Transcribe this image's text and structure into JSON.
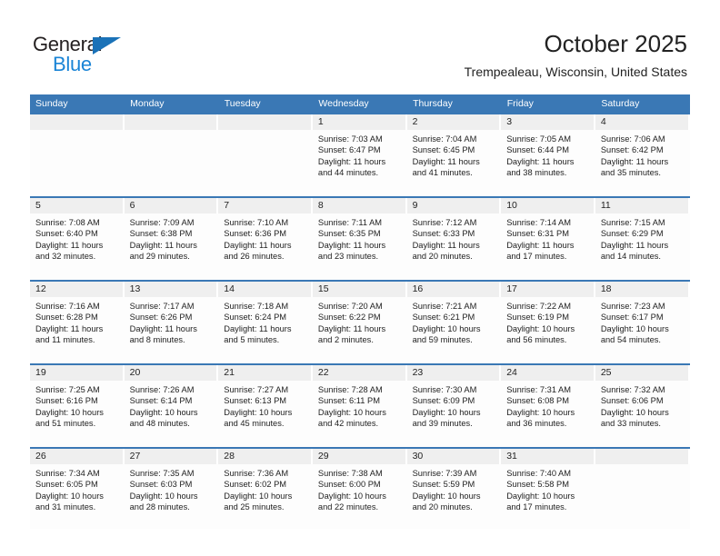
{
  "brand": {
    "name_part1": "General",
    "name_part2": "Blue",
    "triangle_color": "#1a72b8",
    "blue_color": "#1a84d6",
    "dark_color": "#231f20"
  },
  "header": {
    "title": "October 2025",
    "subtitle": "Trempealeau, Wisconsin, United States"
  },
  "theme": {
    "header_bar_color": "#3a78b5",
    "daynum_band_color": "#efefef",
    "row_rule_color": "#3a78b5",
    "text_color": "#222222"
  },
  "weekdays": [
    "Sunday",
    "Monday",
    "Tuesday",
    "Wednesday",
    "Thursday",
    "Friday",
    "Saturday"
  ],
  "weeks": [
    {
      "days": [
        {
          "num": "",
          "sunrise": "",
          "sunset": "",
          "daylight_line1": "",
          "daylight_line2": "",
          "empty": true
        },
        {
          "num": "",
          "sunrise": "",
          "sunset": "",
          "daylight_line1": "",
          "daylight_line2": "",
          "empty": true
        },
        {
          "num": "",
          "sunrise": "",
          "sunset": "",
          "daylight_line1": "",
          "daylight_line2": "",
          "empty": true
        },
        {
          "num": "1",
          "sunrise": "Sunrise: 7:03 AM",
          "sunset": "Sunset: 6:47 PM",
          "daylight_line1": "Daylight: 11 hours",
          "daylight_line2": "and 44 minutes.",
          "empty": false
        },
        {
          "num": "2",
          "sunrise": "Sunrise: 7:04 AM",
          "sunset": "Sunset: 6:45 PM",
          "daylight_line1": "Daylight: 11 hours",
          "daylight_line2": "and 41 minutes.",
          "empty": false
        },
        {
          "num": "3",
          "sunrise": "Sunrise: 7:05 AM",
          "sunset": "Sunset: 6:44 PM",
          "daylight_line1": "Daylight: 11 hours",
          "daylight_line2": "and 38 minutes.",
          "empty": false
        },
        {
          "num": "4",
          "sunrise": "Sunrise: 7:06 AM",
          "sunset": "Sunset: 6:42 PM",
          "daylight_line1": "Daylight: 11 hours",
          "daylight_line2": "and 35 minutes.",
          "empty": false
        }
      ]
    },
    {
      "days": [
        {
          "num": "5",
          "sunrise": "Sunrise: 7:08 AM",
          "sunset": "Sunset: 6:40 PM",
          "daylight_line1": "Daylight: 11 hours",
          "daylight_line2": "and 32 minutes.",
          "empty": false
        },
        {
          "num": "6",
          "sunrise": "Sunrise: 7:09 AM",
          "sunset": "Sunset: 6:38 PM",
          "daylight_line1": "Daylight: 11 hours",
          "daylight_line2": "and 29 minutes.",
          "empty": false
        },
        {
          "num": "7",
          "sunrise": "Sunrise: 7:10 AM",
          "sunset": "Sunset: 6:36 PM",
          "daylight_line1": "Daylight: 11 hours",
          "daylight_line2": "and 26 minutes.",
          "empty": false
        },
        {
          "num": "8",
          "sunrise": "Sunrise: 7:11 AM",
          "sunset": "Sunset: 6:35 PM",
          "daylight_line1": "Daylight: 11 hours",
          "daylight_line2": "and 23 minutes.",
          "empty": false
        },
        {
          "num": "9",
          "sunrise": "Sunrise: 7:12 AM",
          "sunset": "Sunset: 6:33 PM",
          "daylight_line1": "Daylight: 11 hours",
          "daylight_line2": "and 20 minutes.",
          "empty": false
        },
        {
          "num": "10",
          "sunrise": "Sunrise: 7:14 AM",
          "sunset": "Sunset: 6:31 PM",
          "daylight_line1": "Daylight: 11 hours",
          "daylight_line2": "and 17 minutes.",
          "empty": false
        },
        {
          "num": "11",
          "sunrise": "Sunrise: 7:15 AM",
          "sunset": "Sunset: 6:29 PM",
          "daylight_line1": "Daylight: 11 hours",
          "daylight_line2": "and 14 minutes.",
          "empty": false
        }
      ]
    },
    {
      "days": [
        {
          "num": "12",
          "sunrise": "Sunrise: 7:16 AM",
          "sunset": "Sunset: 6:28 PM",
          "daylight_line1": "Daylight: 11 hours",
          "daylight_line2": "and 11 minutes.",
          "empty": false
        },
        {
          "num": "13",
          "sunrise": "Sunrise: 7:17 AM",
          "sunset": "Sunset: 6:26 PM",
          "daylight_line1": "Daylight: 11 hours",
          "daylight_line2": "and 8 minutes.",
          "empty": false
        },
        {
          "num": "14",
          "sunrise": "Sunrise: 7:18 AM",
          "sunset": "Sunset: 6:24 PM",
          "daylight_line1": "Daylight: 11 hours",
          "daylight_line2": "and 5 minutes.",
          "empty": false
        },
        {
          "num": "15",
          "sunrise": "Sunrise: 7:20 AM",
          "sunset": "Sunset: 6:22 PM",
          "daylight_line1": "Daylight: 11 hours",
          "daylight_line2": "and 2 minutes.",
          "empty": false
        },
        {
          "num": "16",
          "sunrise": "Sunrise: 7:21 AM",
          "sunset": "Sunset: 6:21 PM",
          "daylight_line1": "Daylight: 10 hours",
          "daylight_line2": "and 59 minutes.",
          "empty": false
        },
        {
          "num": "17",
          "sunrise": "Sunrise: 7:22 AM",
          "sunset": "Sunset: 6:19 PM",
          "daylight_line1": "Daylight: 10 hours",
          "daylight_line2": "and 56 minutes.",
          "empty": false
        },
        {
          "num": "18",
          "sunrise": "Sunrise: 7:23 AM",
          "sunset": "Sunset: 6:17 PM",
          "daylight_line1": "Daylight: 10 hours",
          "daylight_line2": "and 54 minutes.",
          "empty": false
        }
      ]
    },
    {
      "days": [
        {
          "num": "19",
          "sunrise": "Sunrise: 7:25 AM",
          "sunset": "Sunset: 6:16 PM",
          "daylight_line1": "Daylight: 10 hours",
          "daylight_line2": "and 51 minutes.",
          "empty": false
        },
        {
          "num": "20",
          "sunrise": "Sunrise: 7:26 AM",
          "sunset": "Sunset: 6:14 PM",
          "daylight_line1": "Daylight: 10 hours",
          "daylight_line2": "and 48 minutes.",
          "empty": false
        },
        {
          "num": "21",
          "sunrise": "Sunrise: 7:27 AM",
          "sunset": "Sunset: 6:13 PM",
          "daylight_line1": "Daylight: 10 hours",
          "daylight_line2": "and 45 minutes.",
          "empty": false
        },
        {
          "num": "22",
          "sunrise": "Sunrise: 7:28 AM",
          "sunset": "Sunset: 6:11 PM",
          "daylight_line1": "Daylight: 10 hours",
          "daylight_line2": "and 42 minutes.",
          "empty": false
        },
        {
          "num": "23",
          "sunrise": "Sunrise: 7:30 AM",
          "sunset": "Sunset: 6:09 PM",
          "daylight_line1": "Daylight: 10 hours",
          "daylight_line2": "and 39 minutes.",
          "empty": false
        },
        {
          "num": "24",
          "sunrise": "Sunrise: 7:31 AM",
          "sunset": "Sunset: 6:08 PM",
          "daylight_line1": "Daylight: 10 hours",
          "daylight_line2": "and 36 minutes.",
          "empty": false
        },
        {
          "num": "25",
          "sunrise": "Sunrise: 7:32 AM",
          "sunset": "Sunset: 6:06 PM",
          "daylight_line1": "Daylight: 10 hours",
          "daylight_line2": "and 33 minutes.",
          "empty": false
        }
      ]
    },
    {
      "days": [
        {
          "num": "26",
          "sunrise": "Sunrise: 7:34 AM",
          "sunset": "Sunset: 6:05 PM",
          "daylight_line1": "Daylight: 10 hours",
          "daylight_line2": "and 31 minutes.",
          "empty": false
        },
        {
          "num": "27",
          "sunrise": "Sunrise: 7:35 AM",
          "sunset": "Sunset: 6:03 PM",
          "daylight_line1": "Daylight: 10 hours",
          "daylight_line2": "and 28 minutes.",
          "empty": false
        },
        {
          "num": "28",
          "sunrise": "Sunrise: 7:36 AM",
          "sunset": "Sunset: 6:02 PM",
          "daylight_line1": "Daylight: 10 hours",
          "daylight_line2": "and 25 minutes.",
          "empty": false
        },
        {
          "num": "29",
          "sunrise": "Sunrise: 7:38 AM",
          "sunset": "Sunset: 6:00 PM",
          "daylight_line1": "Daylight: 10 hours",
          "daylight_line2": "and 22 minutes.",
          "empty": false
        },
        {
          "num": "30",
          "sunrise": "Sunrise: 7:39 AM",
          "sunset": "Sunset: 5:59 PM",
          "daylight_line1": "Daylight: 10 hours",
          "daylight_line2": "and 20 minutes.",
          "empty": false
        },
        {
          "num": "31",
          "sunrise": "Sunrise: 7:40 AM",
          "sunset": "Sunset: 5:58 PM",
          "daylight_line1": "Daylight: 10 hours",
          "daylight_line2": "and 17 minutes.",
          "empty": false
        },
        {
          "num": "",
          "sunrise": "",
          "sunset": "",
          "daylight_line1": "",
          "daylight_line2": "",
          "empty": true
        }
      ]
    }
  ]
}
